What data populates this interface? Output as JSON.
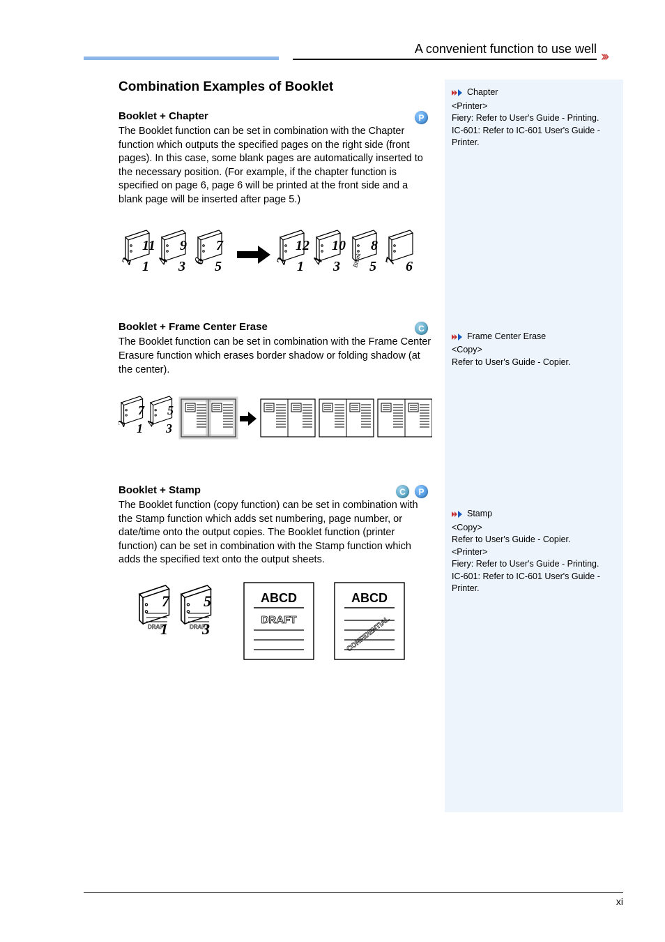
{
  "header": {
    "title": "A convenient function to use well"
  },
  "section": {
    "title": "Combination Examples of Booklet",
    "sub1_title": "Booklet + Chapter",
    "sub1_text": "The Booklet function can be set in combination with the Chapter function which outputs the specified pages on the right side (front pages). In this case, some blank pages are automatically inserted to the necessary position. (For example, if the chapter function is specified on page 6, page 6 will be printed at the front side and a blank page will be inserted after page 5.)",
    "sub2_title": "Booklet + Frame Center Erase",
    "sub2_text": "The Booklet function can be set in combination with the Frame Center Erasure function which erases border shadow or folding shadow (at the center).",
    "sub3_title": "Booklet + Stamp",
    "sub3_text": "The Booklet function (copy function) can be set in combination with the Stamp function which adds set numbering, page number, or date/time onto the output copies. The Booklet function (printer function) can be set in combination with the Stamp function which adds the specified text onto the output sheets."
  },
  "badges": {
    "P": "P",
    "C": "C"
  },
  "side": {
    "chapter": {
      "title": "Chapter",
      "body": "<Printer>\nFiery: Refer to User's Guide - Printing.\nIC-601: Refer to IC-601 User's Guide - Printer."
    },
    "frame": {
      "title": "Frame Center Erase",
      "body": "<Copy>\nRefer to User's Guide - Copier."
    },
    "stamp": {
      "title": "Stamp",
      "body": "<Copy>\nRefer to User's Guide - Copier.\n<Printer>\nFiery: Refer to User's Guide - Printing.\nIC-601: Refer to IC-601 User's Guide - Printer."
    }
  },
  "figures": {
    "fig3_labels": {
      "abcd": "ABCD",
      "draft": "DRAFT",
      "conf": "CONFIDENTIAL"
    }
  },
  "footer": {
    "pageno": "xi"
  }
}
